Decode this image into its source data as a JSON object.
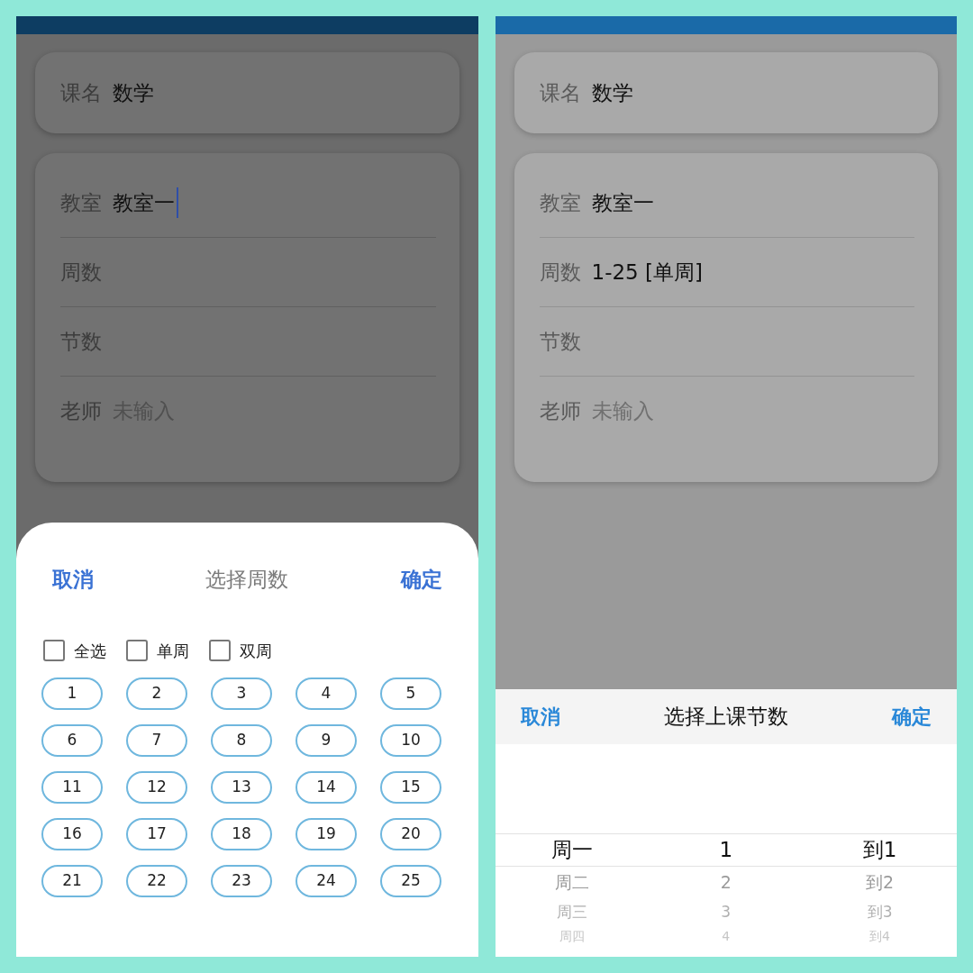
{
  "screens": [
    {
      "form": {
        "course": {
          "label": "课名",
          "value": "数学"
        },
        "fields": [
          {
            "label": "教室",
            "value": "教室一",
            "focused": true
          },
          {
            "label": "周数",
            "focused": false
          },
          {
            "label": "节数",
            "focused": false
          },
          {
            "label": "老师",
            "placeholder": "未输入",
            "focused": false
          }
        ]
      },
      "sheet": {
        "kind": "weeks",
        "cancel": "取消",
        "title": "选择周数",
        "confirm": "确定",
        "options": [
          {
            "label": "全选",
            "checked": false
          },
          {
            "label": "单周",
            "checked": false
          },
          {
            "label": "双周",
            "checked": false
          }
        ],
        "weeks": [
          {
            "label": "1",
            "selected": false
          },
          {
            "label": "2",
            "selected": false
          },
          {
            "label": "3",
            "selected": false
          },
          {
            "label": "4",
            "selected": false
          },
          {
            "label": "5",
            "selected": false
          },
          {
            "label": "6",
            "selected": false
          },
          {
            "label": "7",
            "selected": false
          },
          {
            "label": "8",
            "selected": false
          },
          {
            "label": "9",
            "selected": false
          },
          {
            "label": "10",
            "selected": false
          },
          {
            "label": "11",
            "selected": false
          },
          {
            "label": "12",
            "selected": false
          },
          {
            "label": "13",
            "selected": false
          },
          {
            "label": "14",
            "selected": false
          },
          {
            "label": "15",
            "selected": false
          },
          {
            "label": "16",
            "selected": false
          },
          {
            "label": "17",
            "selected": false
          },
          {
            "label": "18",
            "selected": false
          },
          {
            "label": "19",
            "selected": false
          },
          {
            "label": "20",
            "selected": false
          },
          {
            "label": "21",
            "selected": false
          },
          {
            "label": "22",
            "selected": false
          },
          {
            "label": "23",
            "selected": false
          },
          {
            "label": "24",
            "selected": false
          },
          {
            "label": "25",
            "selected": false
          }
        ]
      }
    },
    {
      "form": {
        "course": {
          "label": "课名",
          "value": "数学"
        },
        "fields": [
          {
            "label": "教室",
            "value": "教室一",
            "focused": false
          },
          {
            "label": "周数",
            "value": "1-25 [单周]",
            "focused": false
          },
          {
            "label": "节数",
            "focused": false
          },
          {
            "label": "老师",
            "placeholder": "未输入",
            "focused": false
          }
        ]
      },
      "sheet": {
        "kind": "periods",
        "cancel": "取消",
        "title": "选择上课节数",
        "confirm": "确定",
        "columns": [
          {
            "items": [
              {
                "label": "周一",
                "selected": true
              },
              {
                "label": "周二",
                "selected": false
              },
              {
                "label": "周三",
                "selected": false
              },
              {
                "label": "周四",
                "selected": false
              }
            ]
          },
          {
            "items": [
              {
                "label": "1",
                "selected": true
              },
              {
                "label": "2",
                "selected": false
              },
              {
                "label": "3",
                "selected": false
              },
              {
                "label": "4",
                "selected": false
              }
            ]
          },
          {
            "items": [
              {
                "label": "到1",
                "selected": true
              },
              {
                "label": "到2",
                "selected": false
              },
              {
                "label": "到3",
                "selected": false
              },
              {
                "label": "到4",
                "selected": false
              }
            ]
          }
        ]
      }
    }
  ]
}
